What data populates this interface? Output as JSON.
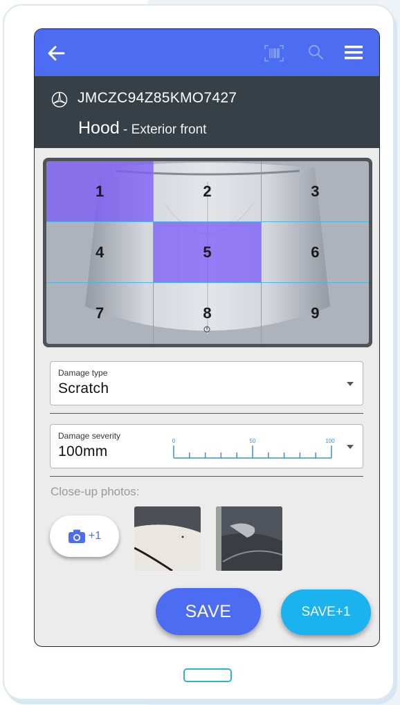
{
  "appbar": {
    "back_icon": "arrow-left-icon",
    "barcode_icon": "barcode-scan-icon",
    "search_icon": "search-icon",
    "menu_icon": "hamburger-menu-icon"
  },
  "vehicle": {
    "brand_icon": "mercedes-star-icon",
    "vin": "JMCZC94Z85KMO7427",
    "part_name": "Hood",
    "part_sub": " - Exterior front"
  },
  "damage_grid": {
    "cells": [
      "1",
      "2",
      "3",
      "4",
      "5",
      "6",
      "7",
      "8",
      "9"
    ],
    "selected": [
      "1",
      "5"
    ]
  },
  "damage_type": {
    "label": "Damage type",
    "value": "Scratch"
  },
  "damage_severity": {
    "label": "Damage severity",
    "value": "100mm",
    "scale_labels": [
      "0",
      "50",
      "100"
    ],
    "scale_level_fraction": 1.0
  },
  "photos": {
    "label": "Close-up photos:",
    "camera_count": "+1",
    "thumbnails": [
      "closeup-photo-1",
      "closeup-photo-2"
    ]
  },
  "actions": {
    "save_label": "SAVE",
    "save_plus_label": "SAVE+1"
  },
  "colors": {
    "primary": "#4c6df1",
    "header_dark": "#374046",
    "accent_cyan": "#1ab2ef",
    "cell_selected": "#7b5cf5"
  }
}
